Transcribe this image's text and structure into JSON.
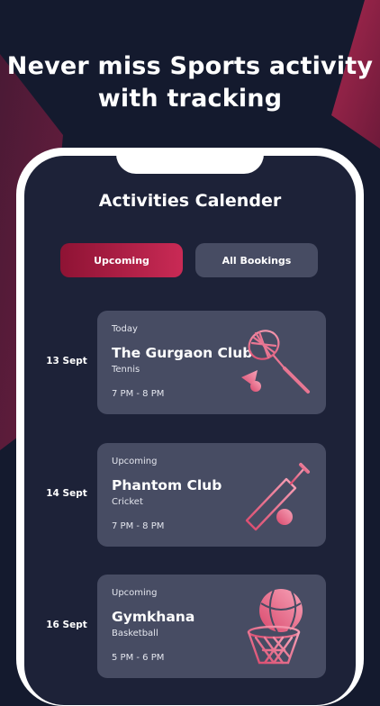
{
  "headline": {
    "line1": "Never miss Sports activity",
    "line2": "with tracking"
  },
  "screen": {
    "title": "Activities Calender",
    "tabs": [
      {
        "label": "Upcoming",
        "active": true
      },
      {
        "label": "All Bookings",
        "active": false
      }
    ]
  },
  "activities": [
    {
      "date": "13 Sept",
      "status": "Today",
      "club": "The Gurgaon Club",
      "sport": "Tennis",
      "time": "7 PM - 8 PM",
      "icon": "badminton-icon"
    },
    {
      "date": "14 Sept",
      "status": "Upcoming",
      "club": "Phantom Club",
      "sport": "Cricket",
      "time": "7 PM - 8 PM",
      "icon": "cricket-icon"
    },
    {
      "date": "16 Sept",
      "status": "Upcoming",
      "club": "Gymkhana",
      "sport": "Basketball",
      "time": "5 PM - 6 PM",
      "icon": "basketball-icon"
    }
  ],
  "colors": {
    "background": "#141a2e",
    "screen": "#1d2238",
    "card": "#474c63",
    "accent": "#c92a55",
    "icon_gradient": [
      "#d9486c",
      "#f7a3b8"
    ]
  }
}
